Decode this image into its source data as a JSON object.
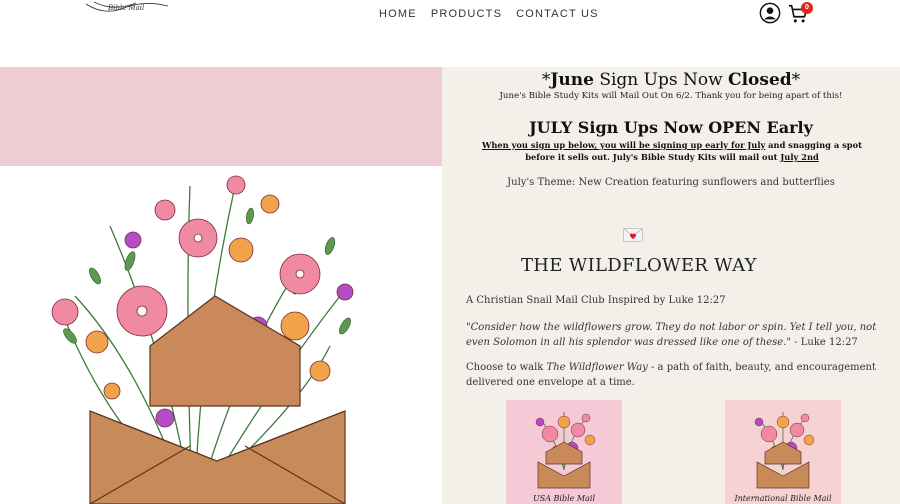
{
  "header": {
    "logo_text": "Bible Mail",
    "nav": [
      "HOME",
      "PRODUCTS",
      "CONTACT US"
    ],
    "cart_count": "0",
    "icons": [
      "account-icon",
      "cart-icon"
    ]
  },
  "announcement": {
    "june_prefix": "*",
    "june_word": "June",
    "june_middle": " Sign Ups Now ",
    "june_closed": "Closed",
    "june_suffix": "*",
    "june_sub": "June's Bible Study Kits will Mail Out On 6/2. Thank you for being apart of this!",
    "july_heading": "JULY Sign Ups Now OPEN Early",
    "july_link": "When you sign up below, you will be signing up early for July",
    "july_text": " and snagging a spot before it sells out. July's Bible Study Kits will mail out ",
    "july_date": "July 2nd",
    "july_theme": "July's Theme: New Creation featuring sunflowers and butterflies"
  },
  "wildflower": {
    "title": "THE WILDFLOWER WAY",
    "subtitle": "A Christian Snail Mail Club Inspired by Luke 12:27",
    "quote": "\"Consider how the wildflowers grow. They do not labor or spin. Yet I tell you, not even Solomon in all his splendor was dressed like one of these.\"",
    "quote_ref": " - Luke 12:27",
    "choose_prefix": "Choose to walk ",
    "choose_italic": "The Wildflower Way",
    "choose_suffix": " - a path of faith, beauty, and encouragement delivered one envelope at a time."
  },
  "products": [
    {
      "label": "USA Bible Mail"
    },
    {
      "label": "International Bible Mail"
    }
  ],
  "colors": {
    "pink_band": "#edccd4",
    "right_panel": "#f3f0ea",
    "badge": "#e0261b",
    "envelope": "#c98a5a"
  }
}
